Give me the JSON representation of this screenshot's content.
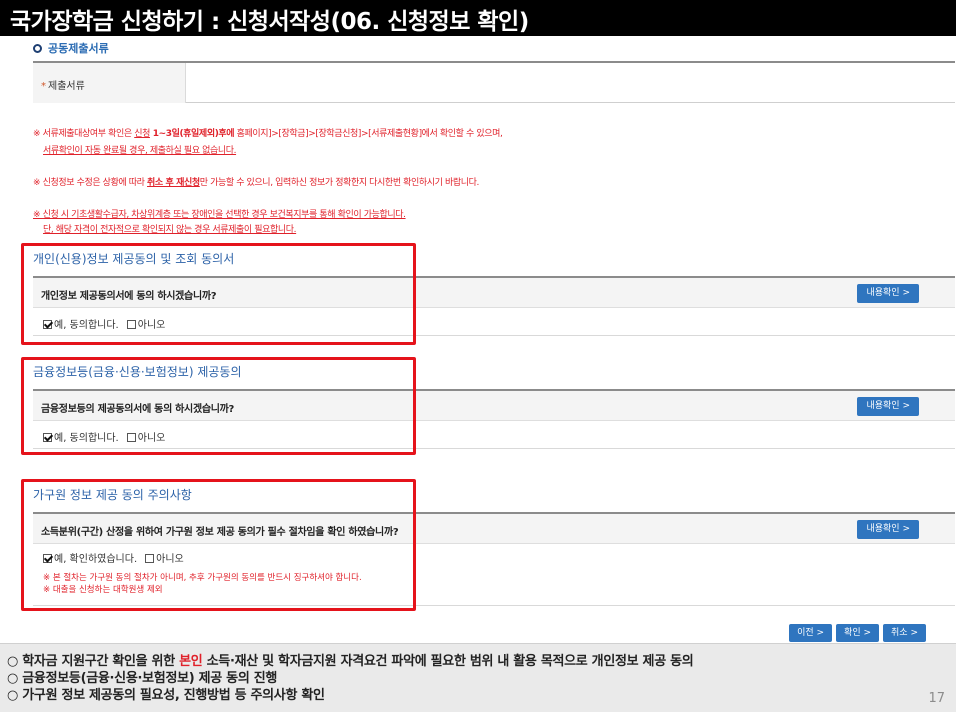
{
  "title": "국가장학금 신청하기 : 신청서작성(06. 신청정보 확인)",
  "common_docs": {
    "heading": "공동제출서류",
    "label": "제출서류",
    "required_mark": "*"
  },
  "notices": {
    "n1_a": "※ 서류제출대상여부 확인은 ",
    "n1_b": "신청",
    "n1_c": " 1~3일(휴일제외)후에",
    "n1_d": " 홈페이지]>[장학금]>[장학금신청]>[서류제출현황]에서 확인할 수 있으며,",
    "n1_e": "서류확인이 자동 완료될 경우, 제출하실 필요 없습니다.",
    "n2_a": "※ 신청정보 수정은 상황에 따라 ",
    "n2_b": "취소 후 재신청",
    "n2_c": "만 가능할 수 있으니, 입력하신 정보가 정확한지 다시한번 확인하시기 바랍니다.",
    "n3_a": "※ 신청 시 기초생활수급자, 차상위계층 또는 장애인을 선택한 경우 보건복지부를 통해 확인이 가능합니다.",
    "n3_b": "단, 해당 자격이 전자적으로 확인되지 않는 경우 서류제출이 필요합니다."
  },
  "consents": [
    {
      "title": "개인(신용)정보 제공동의 및 조회 동의서",
      "question": "개인정보 제공동의서에 동의 하시겠습니까?",
      "button": "내용확인 >",
      "yes": "예, 동의합니다.",
      "no": "아니오"
    },
    {
      "title": "금융정보등(금융·신용·보험정보) 제공동의",
      "question": "금융정보등의 제공동의서에 동의 하시겠습니까?",
      "button": "내용확인 >",
      "yes": "예, 동의합니다.",
      "no": "아니오"
    },
    {
      "title": "가구원 정보 제공 동의 주의사항",
      "question": "소득분위(구간) 산정을 위하여 가구원 정보 제공 동의가 필수 절차임을 확인 하였습니까?",
      "button": "내용확인 >",
      "yes": "예, 확인하였습니다.",
      "no": "아니오",
      "warn1": "※ 본 절차는 가구원 동의 절차가 아니며, 추후 가구원의 동의를 반드시 징구하셔야 합니다.",
      "warn2": "※ 대출을 신청하는 대학원생 제외"
    }
  ],
  "actions": {
    "prev": "이전 >",
    "confirm": "확인 >",
    "cancel": "취소 >"
  },
  "summary": {
    "l1_a": "○ 학자금 지원구간 확인을 위한 ",
    "l1_hl": "본인",
    "l1_b": " 소득·재산 및 학자금지원 자격요건 파악에 필요한 범위 내 활용 목적으로 개인정보 제공 동의",
    "l2": "○ 금융정보등(금융·신용·보험정보) 제공 동의 진행",
    "l3": "○ 가구원 정보 제공동의 필요성, 진행방법 등 주의사항 확인"
  },
  "page_number": "17",
  "colors": {
    "title_bg": "#000000",
    "accent_blue": "#2f75bf",
    "notice_red": "#e0212a",
    "highlight_frame": "#e5131b"
  }
}
